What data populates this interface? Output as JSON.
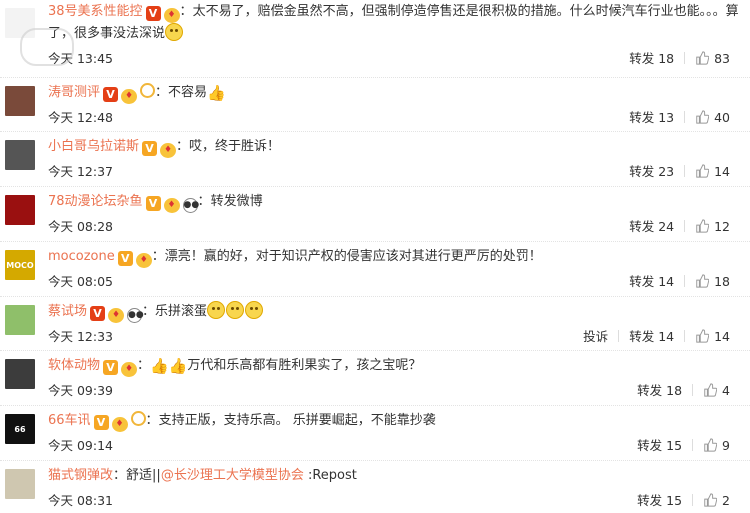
{
  "labels": {
    "repost": "转发",
    "report": "投诉",
    "colon": "："
  },
  "colors": {
    "username": "#eb7350",
    "verified_red": "#e43f16",
    "verified_yellow": "#f6a623",
    "like_icon": "#999999"
  },
  "comments": [
    {
      "user": "38号美系性能控",
      "badges": [
        "verified-red",
        "vip"
      ],
      "text": "太不易了，赔偿金虽然不高，但强制停造停售还是很积极的措施。什么时候汽车行业也能。。。算了，很多事没法深说",
      "suffix_icon": "smirk-emoji",
      "time": "今天 13:45",
      "reposts": "18",
      "likes": "83",
      "avatar_color": "#f3f3f3"
    },
    {
      "user": "涛哥测评",
      "badges": [
        "verified-red",
        "vip",
        "ring"
      ],
      "text": "不容易",
      "suffix_icon": "thumbs-up-emoji",
      "time": "今天 12:48",
      "reposts": "13",
      "likes": "40",
      "avatar_color": "#7a4a3a"
    },
    {
      "user": "小白哥乌拉诺斯",
      "badges": [
        "verified-yellow",
        "vip"
      ],
      "text": "哎，终于胜诉！",
      "time": "今天 12:37",
      "reposts": "23",
      "likes": "14",
      "avatar_color": "#555555"
    },
    {
      "user": "78动漫论坛杂鱼",
      "badges": [
        "verified-yellow",
        "vip",
        "panda"
      ],
      "text": "转发微博",
      "time": "今天 08:28",
      "reposts": "24",
      "likes": "12",
      "avatar_color": "#9a1010"
    },
    {
      "user": "mocozone",
      "badges": [
        "verified-yellow",
        "vip"
      ],
      "text": "漂亮！赢的好，对于知识产权的侵害应该对其进行更严厉的处罚！",
      "time": "今天 08:05",
      "reposts": "14",
      "likes": "18",
      "avatar_color": "#d4a900",
      "avatar_text": "MOCO"
    },
    {
      "user": "蔡试场",
      "badges": [
        "verified-red",
        "vip",
        "panda"
      ],
      "text": "乐拼滚蛋",
      "trailing_emojis": 3,
      "time": "今天 12:33",
      "report": true,
      "reposts": "14",
      "likes": "14",
      "avatar_color": "#8fbf6a"
    },
    {
      "user": "软体动物",
      "badges": [
        "verified-yellow",
        "vip"
      ],
      "prefix_icons": 2,
      "text": "万代和乐高都有胜利果实了，孩之宝呢？",
      "time": "今天 09:39",
      "reposts": "18",
      "likes": "4",
      "avatar_color": "#3c3c3c"
    },
    {
      "user": "66车讯",
      "badges": [
        "verified-yellow",
        "vip",
        "ring"
      ],
      "text": "支持正版，支持乐高。 乐拼要崛起，不能靠抄袭",
      "time": "今天 09:14",
      "reposts": "15",
      "likes": "9",
      "avatar_color": "#111111",
      "avatar_text": "66"
    },
    {
      "user": "猫式钢弹改",
      "badges": [],
      "text_before": "舒适",
      "mention": "@长沙理工大学模型协会",
      "text_after": " :Repost",
      "time": "今天 08:31",
      "reposts": "15",
      "likes": "2",
      "avatar_color": "#cfc7b0"
    }
  ]
}
